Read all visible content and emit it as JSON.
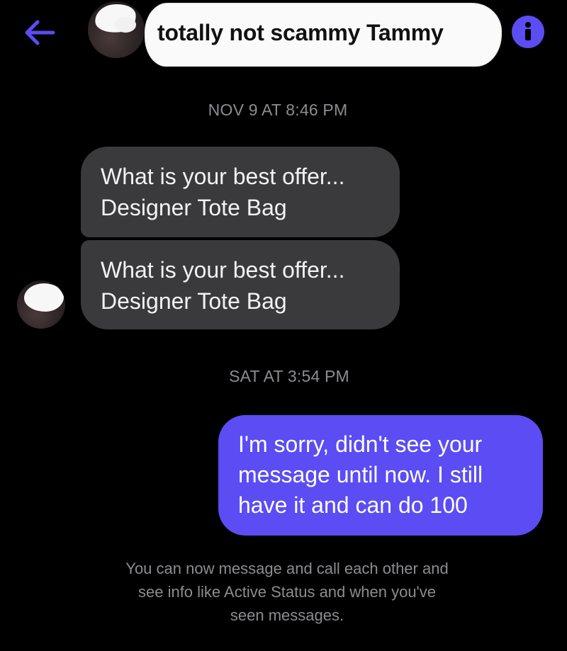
{
  "header": {
    "contact_name": "totally not scammy Tammy",
    "back_icon": "arrow-left-icon",
    "info_icon": "info-icon",
    "accent_color": "#5b4cf3"
  },
  "conversation": {
    "timestamps": [
      "NOV 9 AT 8:46 PM",
      "SAT AT 3:54 PM"
    ],
    "received": [
      {
        "lines": [
          "What is your best offer...",
          "Designer Tote Bag"
        ]
      },
      {
        "lines": [
          "What is your best offer...",
          "Designer Tote Bag"
        ]
      }
    ],
    "sent": [
      {
        "lines": [
          "I'm sorry, didn't see your",
          "message until now. I still",
          "have it and can do 100"
        ]
      }
    ]
  },
  "footer": {
    "lines": [
      "You can now message and call each other and",
      "see info like Active Status and when you've",
      "seen messages."
    ]
  },
  "colors": {
    "background": "#000000",
    "received_bubble": "#3a3a3c",
    "sent_bubble": "#5b4cf3",
    "muted_text": "#8c8c91"
  }
}
